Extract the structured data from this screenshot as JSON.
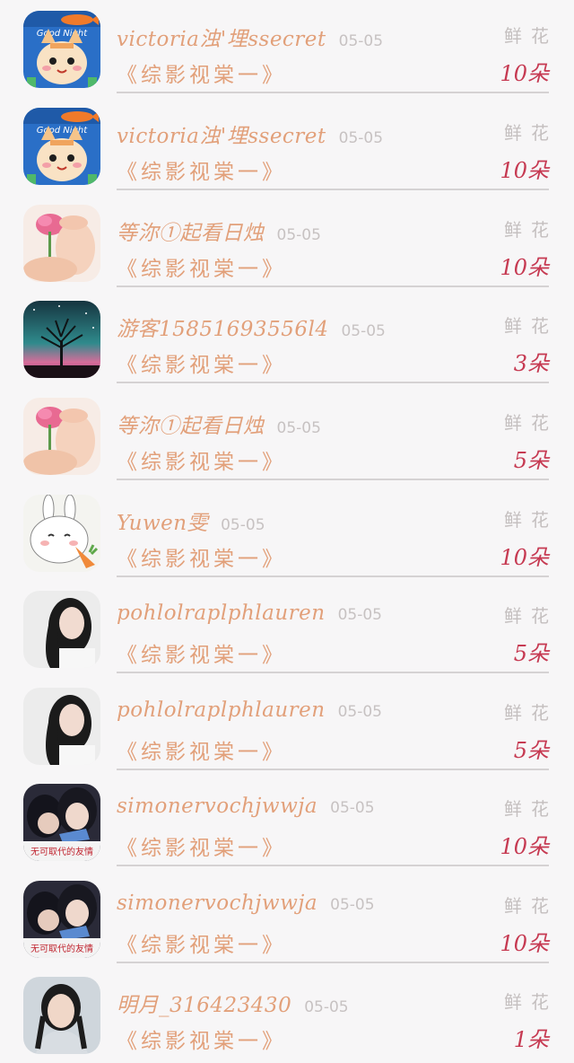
{
  "items": [
    {
      "name": "victoria浊'埋ssecret",
      "date": "05-05",
      "book": "《综影视棠一》",
      "gift": "鲜花",
      "count": "10朵",
      "avatar": "cat-cartoon"
    },
    {
      "name": "victoria浊'埋ssecret",
      "date": "05-05",
      "book": "《综影视棠一》",
      "gift": "鲜花",
      "count": "10朵",
      "avatar": "cat-cartoon"
    },
    {
      "name": "等沵①起看日烛",
      "date": "05-05",
      "book": "《综影视棠一》",
      "gift": "鲜花",
      "count": "10朵",
      "avatar": "flower-feet"
    },
    {
      "name": "游客15851693556l4",
      "date": "05-05",
      "book": "《综影视棠一》",
      "gift": "鲜花",
      "count": "3朵",
      "avatar": "tree-night"
    },
    {
      "name": "等沵①起看日烛",
      "date": "05-05",
      "book": "《综影视棠一》",
      "gift": "鲜花",
      "count": "5朵",
      "avatar": "flower-feet"
    },
    {
      "name": "Yuwen雯",
      "date": "05-05",
      "book": "《综影视棠一》",
      "gift": "鲜花",
      "count": "10朵",
      "avatar": "rabbit-carrot"
    },
    {
      "name": "pohlolraplphlauren",
      "date": "05-05",
      "book": "《综影视棠一》",
      "gift": "鲜花",
      "count": "5朵",
      "avatar": "girl-photo"
    },
    {
      "name": "pohlolraplphlauren",
      "date": "05-05",
      "book": "《综影视棠一》",
      "gift": "鲜花",
      "count": "5朵",
      "avatar": "girl-photo"
    },
    {
      "name": "simonervochjwwja",
      "date": "05-05",
      "book": "《综影视棠一》",
      "gift": "鲜花",
      "count": "10朵",
      "avatar": "friendship-photo",
      "avatar_caption": "无可取代的友情"
    },
    {
      "name": "simonervochjwwja",
      "date": "05-05",
      "book": "《综影视棠一》",
      "gift": "鲜花",
      "count": "10朵",
      "avatar": "friendship-photo",
      "avatar_caption": "无可取代的友情"
    },
    {
      "name": "明月_316423430",
      "date": "05-05",
      "book": "《综影视棠一》",
      "gift": "鲜花",
      "count": "1朵",
      "avatar": "woman-portrait"
    }
  ],
  "avatar_texts": {
    "cat_sign": "Good Night"
  },
  "colors": {
    "name": "#e2a07a",
    "date": "#c7c2c2",
    "count": "#c63a52",
    "divider": "#d5d2d3",
    "background": "#f7f6f7"
  }
}
